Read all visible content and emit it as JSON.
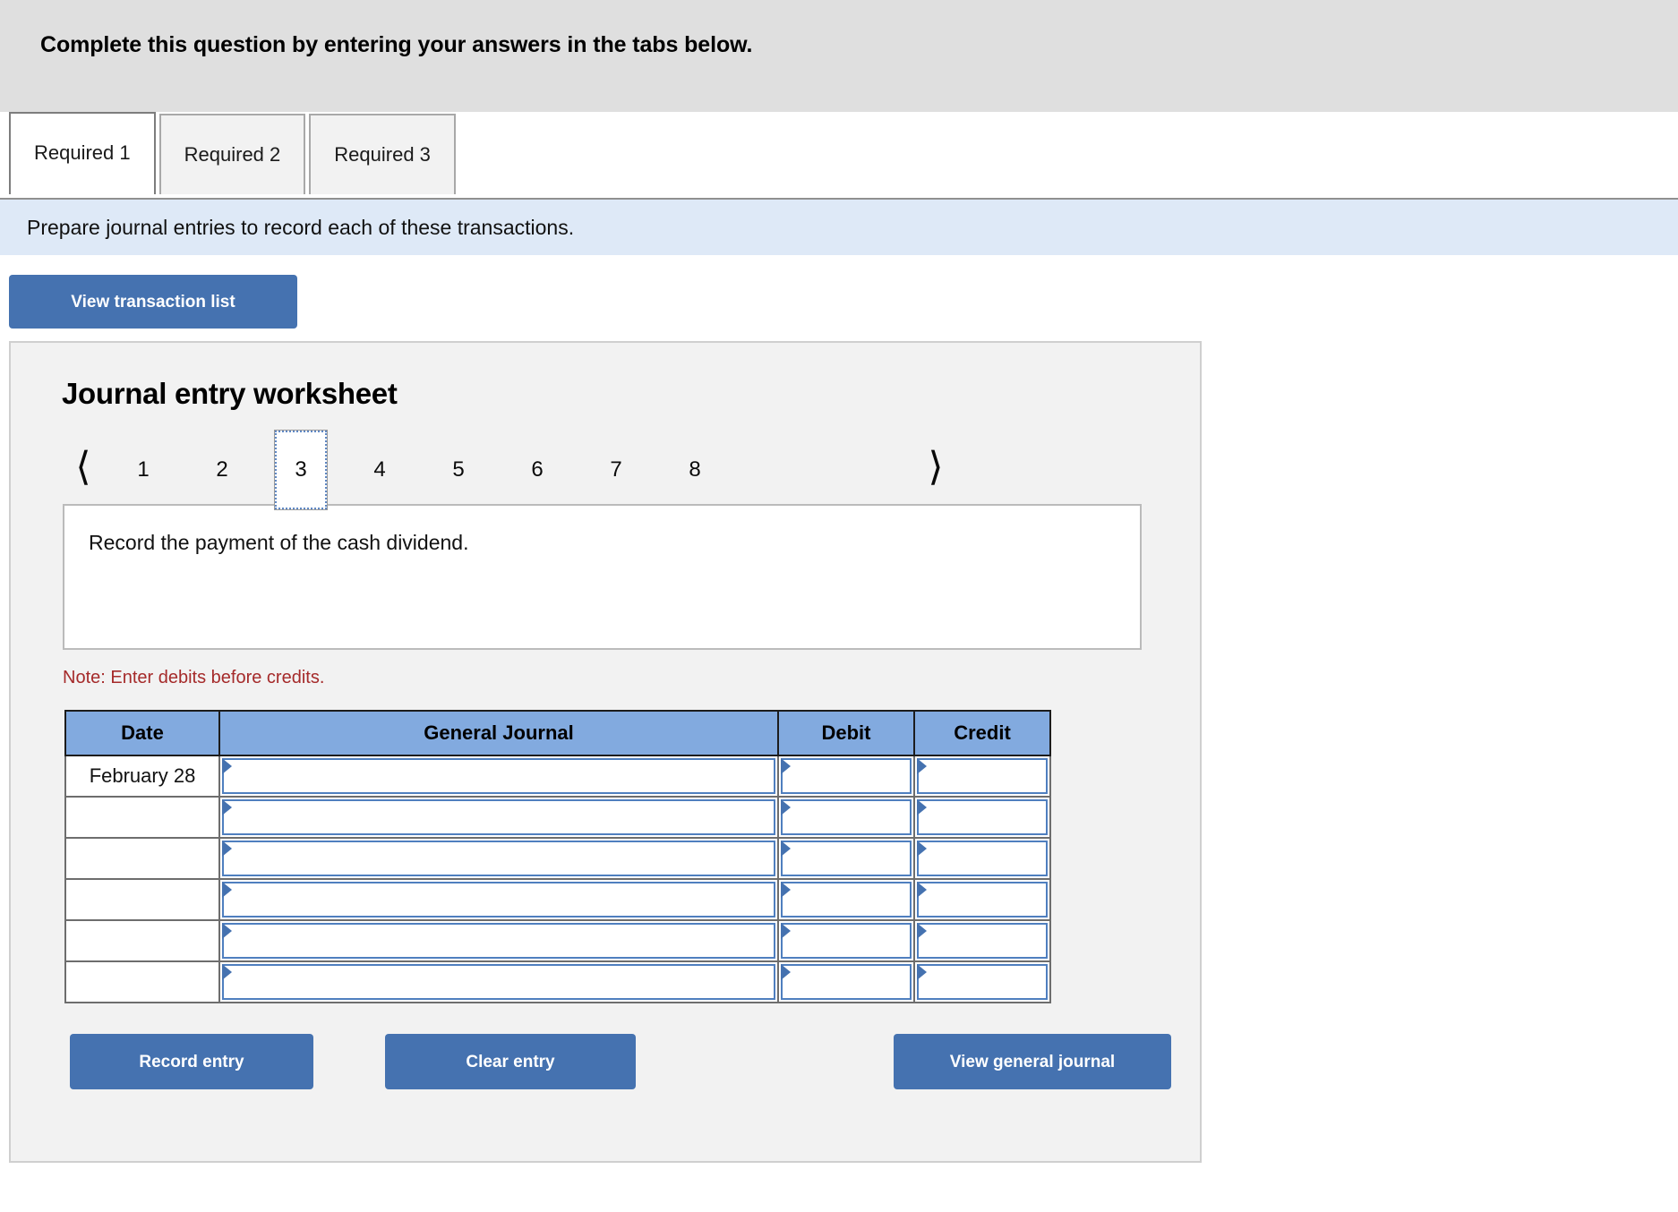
{
  "banner": {
    "text": "Complete this question by entering your answers in the tabs below."
  },
  "tabs": [
    {
      "label": "Required 1",
      "active": true
    },
    {
      "label": "Required 2",
      "active": false
    },
    {
      "label": "Required 3",
      "active": false
    }
  ],
  "instruction": {
    "text": "Prepare journal entries to record each of these transactions."
  },
  "toolbar": {
    "view_transaction_list_label": "View transaction list"
  },
  "worksheet": {
    "title": "Journal entry worksheet",
    "pager": {
      "prev_icon": "chevron-left-icon",
      "next_icon": "chevron-right-icon",
      "pages": [
        "1",
        "2",
        "3",
        "4",
        "5",
        "6",
        "7",
        "8"
      ],
      "selected": "3"
    },
    "description": "Record the payment of the cash dividend.",
    "note": "Note: Enter debits before credits.",
    "table": {
      "headers": [
        "Date",
        "General Journal",
        "Debit",
        "Credit"
      ],
      "rows": [
        {
          "date": "February 28",
          "general_journal": "",
          "debit": "",
          "credit": ""
        },
        {
          "date": "",
          "general_journal": "",
          "debit": "",
          "credit": ""
        },
        {
          "date": "",
          "general_journal": "",
          "debit": "",
          "credit": ""
        },
        {
          "date": "",
          "general_journal": "",
          "debit": "",
          "credit": ""
        },
        {
          "date": "",
          "general_journal": "",
          "debit": "",
          "credit": ""
        },
        {
          "date": "",
          "general_journal": "",
          "debit": "",
          "credit": ""
        }
      ]
    },
    "actions": {
      "record_label": "Record entry",
      "clear_label": "Clear entry",
      "view_journal_label": "View general journal"
    }
  },
  "colors": {
    "banner_gray": "#dfdfdf",
    "instruction_blue": "#dee9f7",
    "button_blue": "#4572b0",
    "table_header_blue": "#82aadf",
    "note_red": "#a52a2a",
    "panel_gray": "#f2f2f2"
  }
}
